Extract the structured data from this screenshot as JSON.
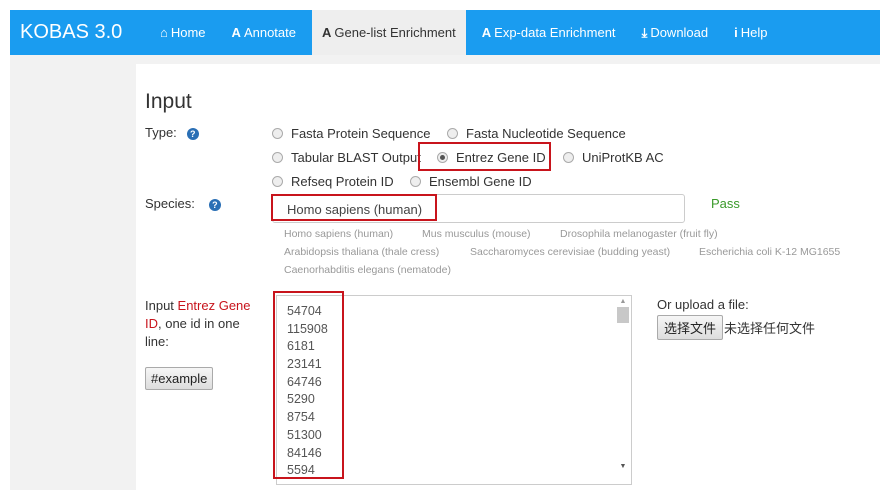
{
  "navbar": {
    "brand": "KOBAS 3.0",
    "items": [
      {
        "label": "Home",
        "icon": "home-icon",
        "glyph": "⌂"
      },
      {
        "label": "Annotate",
        "icon": "annotate-icon",
        "glyph": "A"
      },
      {
        "label": "Gene-list Enrichment",
        "icon": "enrichment-icon",
        "glyph": "A",
        "active": true
      },
      {
        "label": "Exp-data Enrichment",
        "icon": "exp-icon",
        "glyph": "A"
      },
      {
        "label": "Download",
        "icon": "download-icon",
        "glyph": "⤓"
      },
      {
        "label": "Help",
        "icon": "info-icon",
        "glyph": "i"
      }
    ]
  },
  "form": {
    "title": "Input",
    "type_label": "Type:",
    "type_options": [
      "Fasta Protein Sequence",
      "Fasta Nucleotide Sequence",
      "Tabular BLAST Output",
      "Entrez Gene ID",
      "UniProtKB AC",
      "Refseq Protein ID",
      "Ensembl Gene ID"
    ],
    "type_selected": "Entrez Gene ID",
    "species_label": "Species:",
    "species_value": "Homo sapiens (human)",
    "species_status": "Pass",
    "species_suggestions": [
      "Homo sapiens (human)",
      "Mus musculus (mouse)",
      "Drosophila melanogaster (fruit fly)",
      "Arabidopsis thaliana (thale cress)",
      "Saccharomyces cerevisiae (budding yeast)",
      "Escherichia coli K-12 MG1655",
      "Caenorhabditis elegans (nematode)"
    ],
    "input_label_prefix": "Input ",
    "input_label_highlight": "Entrez Gene ID",
    "input_label_suffix": ", one id in one line:",
    "example_button": "#example",
    "gene_ids": [
      "54704",
      "115908",
      "6181",
      "23141",
      "64746",
      "5290",
      "8754",
      "51300",
      "84146",
      "5594"
    ],
    "upload_label": "Or upload a file:",
    "choose_file_button": "选择文件",
    "no_file_text": "未选择任何文件"
  },
  "colors": {
    "nav": "#1a9cf0",
    "highlight": "#c8141c",
    "pass": "#3a9a2a"
  }
}
